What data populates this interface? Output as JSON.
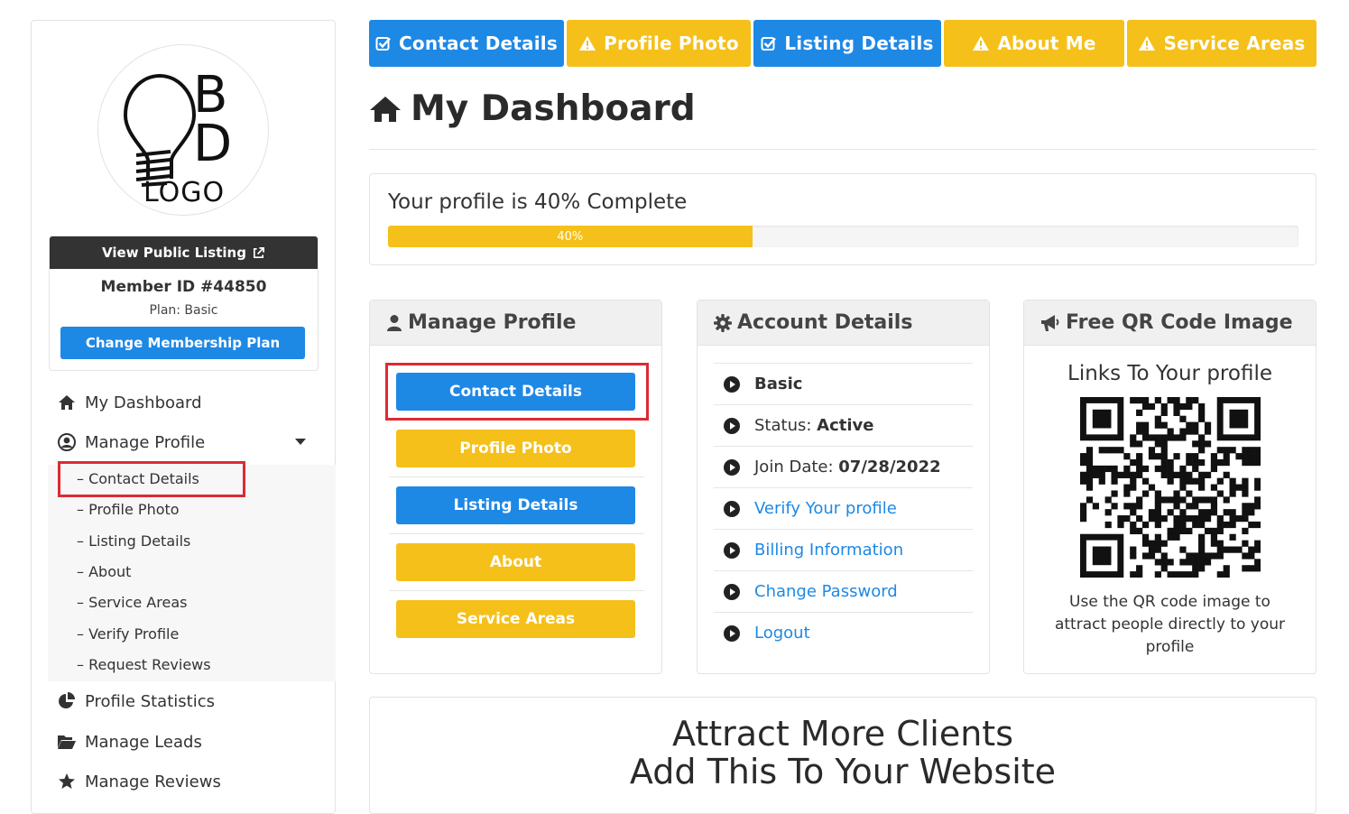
{
  "sidebar": {
    "logo": {
      "letter_top": "B",
      "letter_bottom": "D",
      "text": "LOGO"
    },
    "view_public_label": "View Public Listing",
    "member_id": "Member ID #44850",
    "plan": "Plan: Basic",
    "change_plan_label": "Change Membership Plan",
    "nav": {
      "dashboard": "My Dashboard",
      "manage_profile": "Manage Profile",
      "profile_statistics": "Profile Statistics",
      "manage_leads": "Manage Leads",
      "manage_reviews": "Manage Reviews"
    },
    "submenu": [
      "– Contact Details",
      "– Profile Photo",
      "– Listing Details",
      "– About",
      "– Service Areas",
      "– Verify Profile",
      "– Request Reviews"
    ]
  },
  "tabs": [
    {
      "label": "Contact Details",
      "status": "done",
      "color": "#1e88e5"
    },
    {
      "label": "Profile Photo",
      "status": "warning",
      "color": "#f5c01a"
    },
    {
      "label": "Listing Details",
      "status": "done",
      "color": "#1e88e5"
    },
    {
      "label": "About Me",
      "status": "warning",
      "color": "#f5c01a"
    },
    {
      "label": "Service Areas",
      "status": "warning",
      "color": "#f5c01a"
    }
  ],
  "page_title": "My Dashboard",
  "progress": {
    "text": "Your profile is 40% Complete",
    "value": 40,
    "label": "40%"
  },
  "manage_profile": {
    "title": "Manage Profile",
    "buttons": [
      "Contact Details",
      "Profile Photo",
      "Listing Details",
      "About",
      "Service Areas"
    ]
  },
  "account": {
    "title": "Account Details",
    "plan": "Basic",
    "status_label": "Status:",
    "status_value": "Active",
    "join_label": "Join Date:",
    "join_value": "07/28/2022",
    "links": {
      "verify": "Verify Your profile",
      "billing": "Billing Information",
      "password": "Change Password",
      "logout": "Logout"
    }
  },
  "qr": {
    "title": "Free QR Code Image",
    "subtitle": "Links To Your profile",
    "description": "Use the QR code image to attract people directly to your profile"
  },
  "attract": {
    "line1": "Attract More Clients",
    "line2": "Add This To Your Website"
  },
  "colors": {
    "blue": "#1e88e5",
    "yellow": "#f5c01a",
    "highlight_red": "#dd2a35",
    "dark_bar": "#333333"
  }
}
